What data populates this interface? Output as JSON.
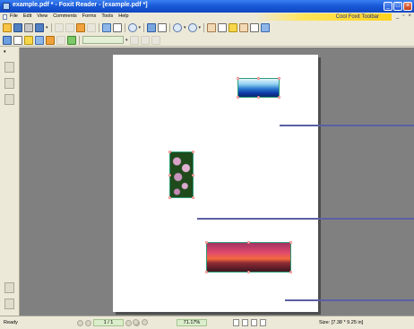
{
  "window": {
    "title": "example.pdf * - Foxit Reader - [example.pdf *]",
    "controls": {
      "minimize": "_",
      "maximize": "□",
      "close": "×"
    }
  },
  "menu": {
    "items": [
      "File",
      "Edit",
      "View",
      "Comments",
      "Forms",
      "Tools",
      "Help"
    ],
    "promo": "Cool Foxit Toolbar",
    "doc_controls": {
      "minimize": "_",
      "restore": "▫",
      "close": "×"
    }
  },
  "statusbar": {
    "ready": "Ready",
    "page": "1 / 1",
    "zoom": "71.17%",
    "size": "Size: [7.38 * 9.25 in]"
  }
}
